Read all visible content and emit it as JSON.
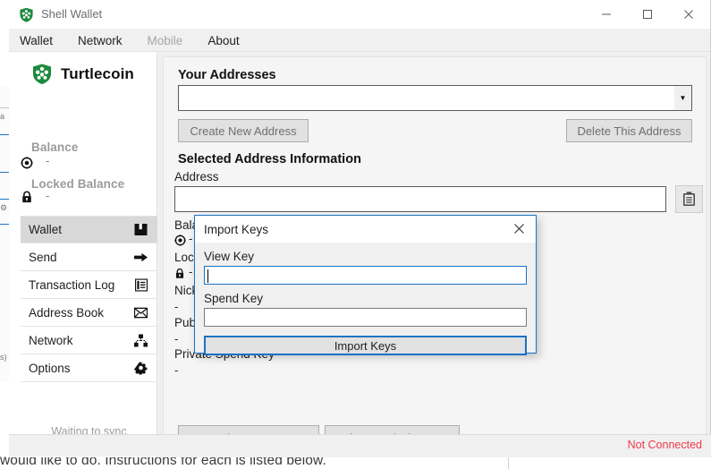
{
  "window": {
    "title": "Shell Wallet",
    "icon": "turtlecoin-shield-icon",
    "controls": {
      "minimize": "–",
      "maximize": "□",
      "close": "✕"
    }
  },
  "menu": {
    "items": [
      {
        "label": "Wallet",
        "disabled": false
      },
      {
        "label": "Network",
        "disabled": false
      },
      {
        "label": "Mobile",
        "disabled": true
      },
      {
        "label": "About",
        "disabled": false
      }
    ]
  },
  "sidebar": {
    "brand": "Turtlecoin",
    "balance": {
      "label": "Balance",
      "value": "-",
      "icon": "coin-icon"
    },
    "locked_balance": {
      "label": "Locked Balance",
      "value": "-",
      "icon": "lock-icon"
    },
    "nav": [
      {
        "label": "Wallet",
        "icon": "wallet-icon",
        "selected": true
      },
      {
        "label": "Send",
        "icon": "arrow-right-icon",
        "selected": false
      },
      {
        "label": "Transaction Log",
        "icon": "log-book-icon",
        "selected": false
      },
      {
        "label": "Address Book",
        "icon": "envelope-icon",
        "selected": false
      },
      {
        "label": "Network",
        "icon": "network-icon",
        "selected": false
      },
      {
        "label": "Options",
        "icon": "gear-icon",
        "selected": false
      }
    ],
    "sync_status": "Waiting to sync",
    "sync_progress": 0
  },
  "main": {
    "addresses_title": "Your Addresses",
    "address_select_value": "",
    "create_button": "Create New Address",
    "delete_button": "Delete This Address",
    "selected_title": "Selected Address Information",
    "fields": {
      "address_label": "Address",
      "address_value": "",
      "balance_label": "Balance",
      "balance_value": "-",
      "locked_label": "Locked Balance",
      "locked_value": "-",
      "nickname_label": "Nickname",
      "nickname_value": "-",
      "public_spend_label": "Public Spend Key",
      "public_spend_value": "-",
      "private_spend_label": "Private Spend Key",
      "private_spend_value": "-"
    },
    "copy_icon": "clipboard-icon",
    "show_keys_button": "Show Keys",
    "change_nickname_button": "Change Nicckname"
  },
  "status_bar": {
    "connection": "Not Connected",
    "connection_color": "#ef3a4a"
  },
  "modal": {
    "title": "Import Keys",
    "close_icon": "close-icon",
    "view_key_label": "View Key",
    "view_key_value": "",
    "spend_key_label": "Spend Key",
    "spend_key_value": "",
    "import_button": "Import Keys",
    "focus_color": "#1b72c4"
  },
  "backdrop": {
    "text": "would like to do. Instructions for each is listed below."
  },
  "colors": {
    "brand_green": "#1c8a3c",
    "accent_blue": "#1b72c4",
    "error_red": "#ef3a4a"
  }
}
